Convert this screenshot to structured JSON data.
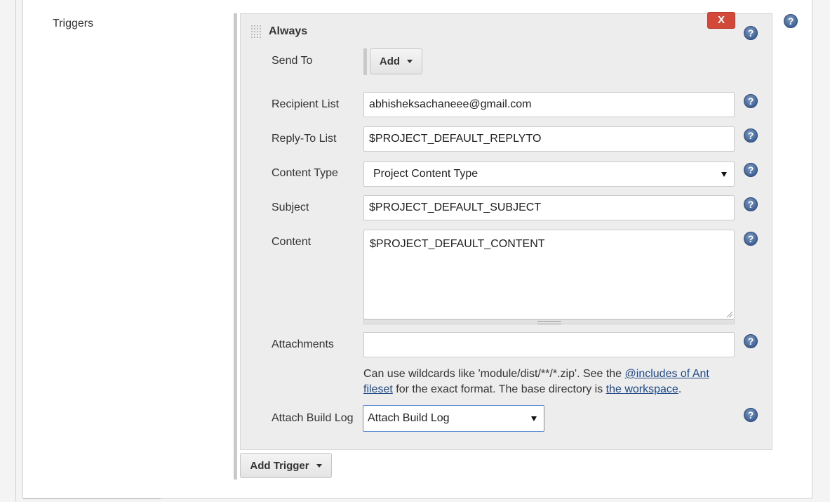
{
  "section": {
    "label": "Triggers"
  },
  "trigger": {
    "title": "Always",
    "delete_label": "X"
  },
  "help_glyph": "?",
  "fields": {
    "send_to": {
      "label": "Send To",
      "add_button": "Add"
    },
    "recipient_list": {
      "label": "Recipient List",
      "value": "abhisheksachaneee@gmail.com"
    },
    "reply_to_list": {
      "label": "Reply-To List",
      "value": "$PROJECT_DEFAULT_REPLYTO"
    },
    "content_type": {
      "label": "Content Type",
      "selected": "Project Content Type"
    },
    "subject": {
      "label": "Subject",
      "value": "$PROJECT_DEFAULT_SUBJECT"
    },
    "content": {
      "label": "Content",
      "value": "$PROJECT_DEFAULT_CONTENT"
    },
    "attachments": {
      "label": "Attachments",
      "value": "",
      "help_prefix": "Can use wildcards like 'module/dist/**/*.zip'. See the ",
      "help_link1": "@includes of Ant fileset",
      "help_middle": " for the exact format. The base directory is ",
      "help_link2": "the workspace",
      "help_suffix": "."
    },
    "attach_build_log": {
      "label": "Attach Build Log",
      "selected": "Attach Build Log"
    }
  },
  "add_trigger_label": "Add Trigger",
  "colors": {
    "delete_button": "#d24939",
    "help_icon": "#3d5f94",
    "link": "#204a87",
    "focus_border": "#5b8bd0"
  }
}
